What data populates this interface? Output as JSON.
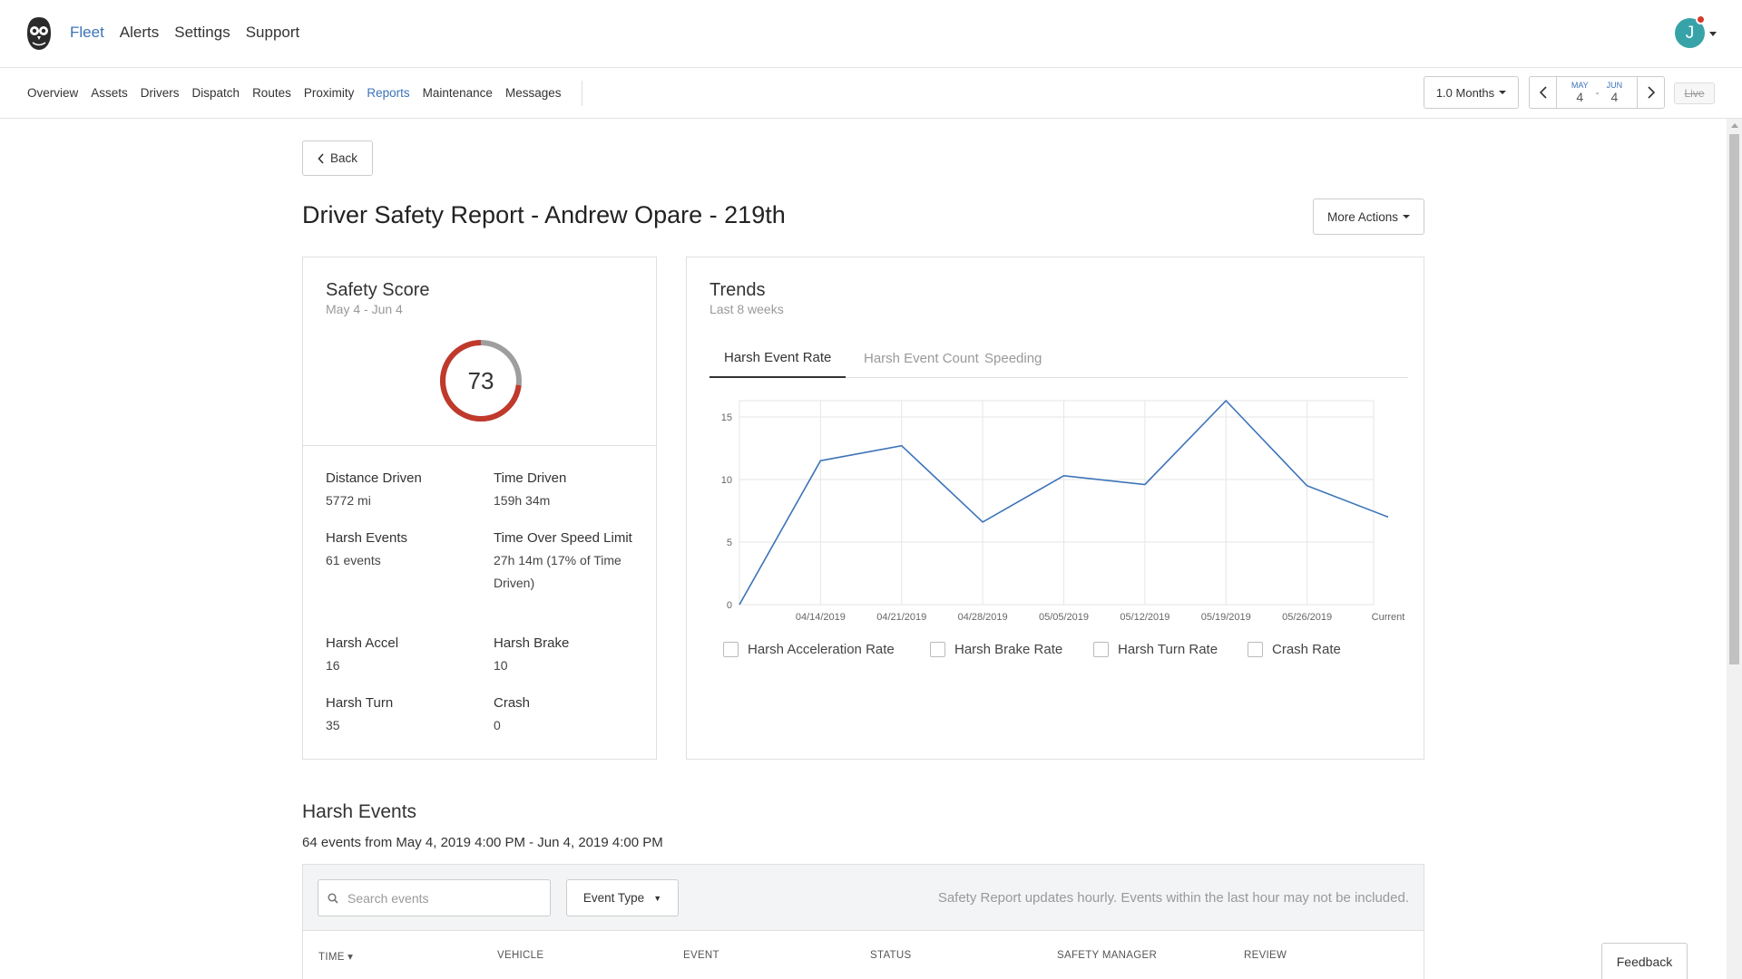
{
  "header": {
    "nav": [
      "Fleet",
      "Alerts",
      "Settings",
      "Support"
    ],
    "active_nav": "Fleet",
    "avatar_letter": "J"
  },
  "subnav": {
    "items": [
      "Overview",
      "Assets",
      "Drivers",
      "Dispatch",
      "Routes",
      "Proximity",
      "Reports",
      "Maintenance",
      "Messages"
    ],
    "active": "Reports",
    "range_label": "1.0 Months",
    "date_start": {
      "month": "MAY",
      "day": "4"
    },
    "date_end": {
      "month": "JUN",
      "day": "4"
    },
    "date_sep": "-",
    "live_label": "Live"
  },
  "page": {
    "back_label": "Back",
    "title": "Driver Safety Report - Andrew Opare - 219th",
    "more_actions_label": "More Actions"
  },
  "safety": {
    "title": "Safety Score",
    "range": "May 4 - Jun 4",
    "score": "73",
    "score_fraction": 0.73,
    "score_color": "#c0392b",
    "track_color": "#9e9e9e",
    "stats": [
      {
        "label": "Distance Driven",
        "value": "5772 mi"
      },
      {
        "label": "Time Driven",
        "value": "159h 34m"
      },
      {
        "label": "Harsh Events",
        "value": "61 events"
      },
      {
        "label": "Time Over Speed Limit",
        "value": "27h 14m (17% of Time Driven)"
      },
      {
        "label": "Harsh Accel",
        "value": "16"
      },
      {
        "label": "Harsh Brake",
        "value": "10"
      },
      {
        "label": "Harsh Turn",
        "value": "35"
      },
      {
        "label": "Crash",
        "value": "0"
      }
    ]
  },
  "trends": {
    "title": "Trends",
    "subtitle": "Last 8 weeks",
    "tabs": [
      "Harsh Event Rate",
      "Harsh Event Count",
      "Speeding"
    ],
    "active_tab": "Harsh Event Rate",
    "legend": [
      "Harsh Acceleration Rate",
      "Harsh Brake Rate",
      "Harsh Turn Rate",
      "Crash Rate"
    ]
  },
  "chart_data": {
    "type": "line",
    "x": [
      "",
      "04/14/2019",
      "04/21/2019",
      "04/28/2019",
      "05/05/2019",
      "05/12/2019",
      "05/19/2019",
      "05/26/2019",
      "Current"
    ],
    "series": [
      {
        "values": [
          0,
          11.5,
          12.7,
          6.6,
          10.3,
          9.6,
          16.3,
          9.5,
          7.0
        ],
        "color": "#3b73b9"
      }
    ],
    "yticks": [
      0,
      5,
      10,
      15
    ],
    "ylim": [
      0,
      16.3
    ],
    "grid": true
  },
  "events": {
    "title": "Harsh Events",
    "summary": "64 events from May 4, 2019 4:00 PM - Jun 4, 2019 4:00 PM",
    "search_placeholder": "Search events",
    "event_type_label": "Event Type",
    "note": "Safety Report updates hourly. Events within the last hour may not be included.",
    "columns": [
      "TIME ▾",
      "VEHICLE",
      "EVENT",
      "STATUS",
      "SAFETY MANAGER",
      "REVIEW"
    ]
  },
  "feedback_label": "Feedback"
}
